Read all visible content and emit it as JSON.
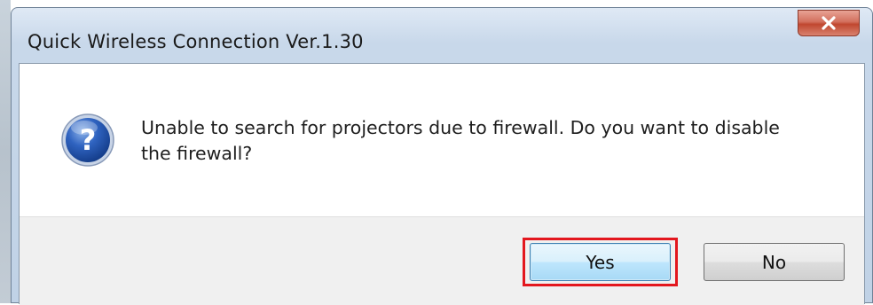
{
  "window": {
    "title": "Quick Wireless Connection Ver.1.30"
  },
  "dialog": {
    "icon": "question-icon",
    "message": "Unable to search for projectors due to firewall. Do you want to disable the firewall?"
  },
  "buttons": {
    "yes_label": "Yes",
    "no_label": "No"
  },
  "colors": {
    "highlight": "#e3171e",
    "close_button": "#c0472f",
    "icon_blue": "#1f4fa8"
  }
}
